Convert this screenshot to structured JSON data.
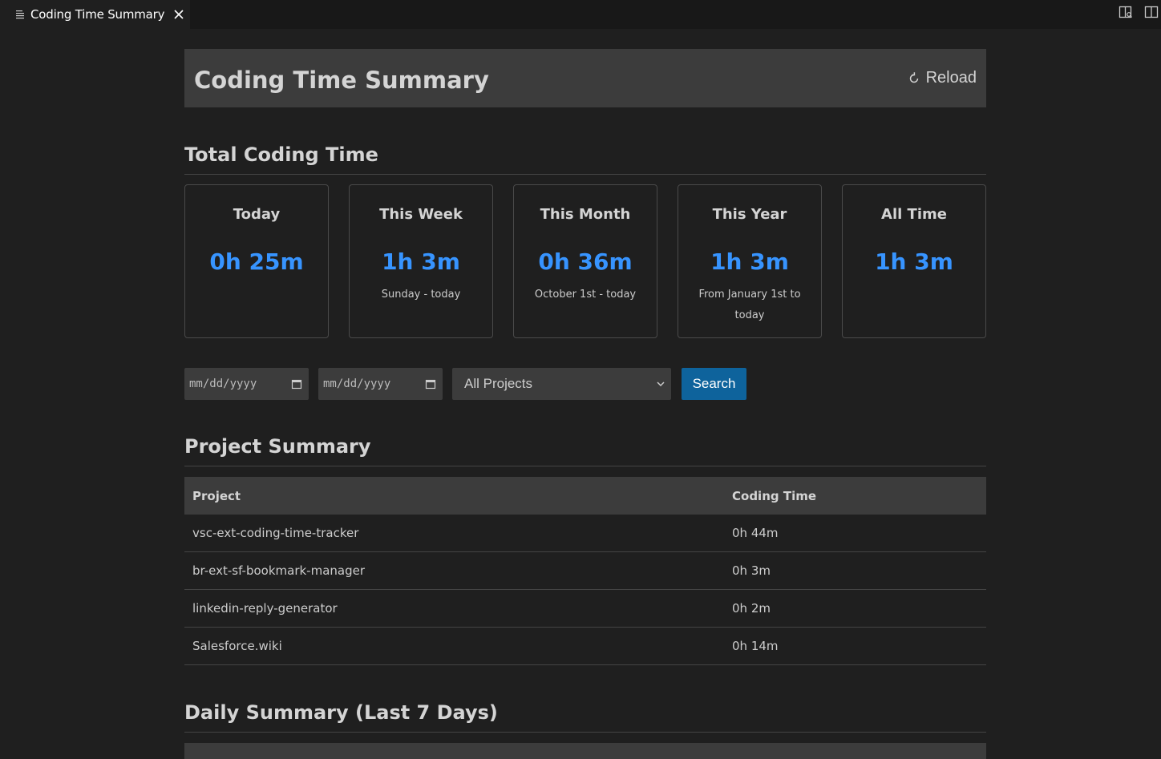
{
  "tab": {
    "title": "Coding Time Summary"
  },
  "header": {
    "title": "Coding Time Summary",
    "reload_label": "Reload"
  },
  "total": {
    "heading": "Total Coding Time",
    "cards": [
      {
        "title": "Today",
        "value": "0h 25m",
        "note": ""
      },
      {
        "title": "This Week",
        "value": "1h 3m",
        "note": "Sunday - today"
      },
      {
        "title": "This Month",
        "value": "0h 36m",
        "note": "October 1st - today"
      },
      {
        "title": "This Year",
        "value": "1h 3m",
        "note": "From January 1st to today"
      },
      {
        "title": "All Time",
        "value": "1h 3m",
        "note": ""
      }
    ]
  },
  "filters": {
    "start_date_placeholder": "mm/dd/yyyy",
    "end_date_placeholder": "mm/dd/yyyy",
    "project_selected": "All Projects",
    "search_label": "Search"
  },
  "project_summary": {
    "heading": "Project Summary",
    "columns": [
      "Project",
      "Coding Time"
    ],
    "rows": [
      {
        "project": "vsc-ext-coding-time-tracker",
        "time": "0h 44m"
      },
      {
        "project": "br-ext-sf-bookmark-manager",
        "time": "0h 3m"
      },
      {
        "project": "linkedin-reply-generator",
        "time": "0h 2m"
      },
      {
        "project": "Salesforce.wiki",
        "time": "0h 14m"
      }
    ]
  },
  "daily_summary": {
    "heading": "Daily Summary (Last 7 Days)"
  },
  "colors": {
    "accent": "#3794ff",
    "button": "#0e639c",
    "background": "#1f1f1f",
    "panel": "#3c3c3c"
  }
}
